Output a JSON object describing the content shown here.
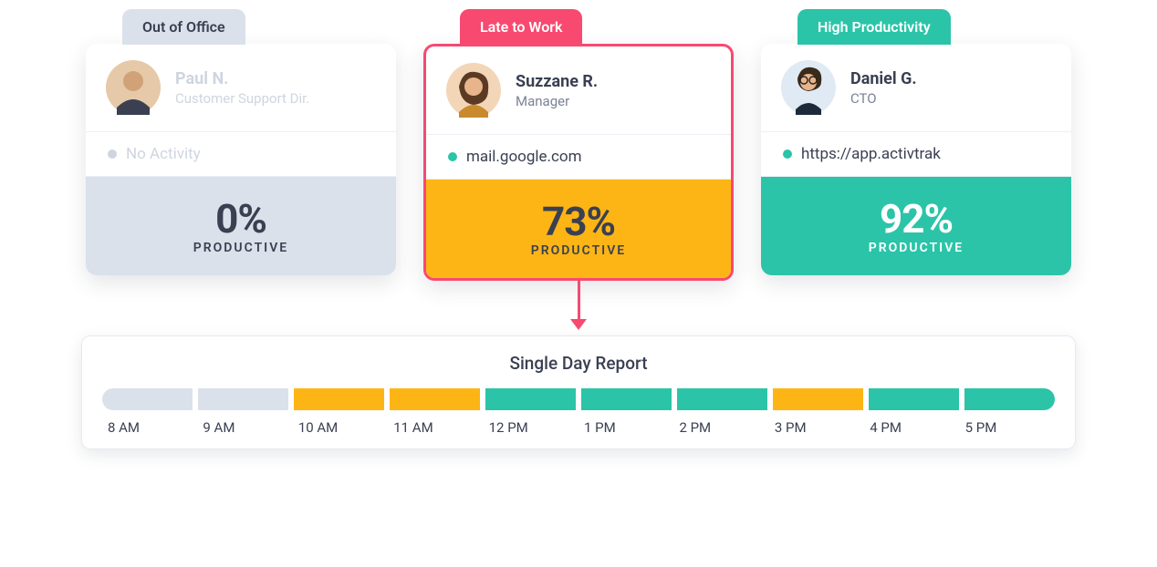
{
  "cards": [
    {
      "tab": "Out of Office",
      "tabStyle": "gray",
      "name": "Paul N.",
      "role": "Customer Support Dir.",
      "activity": "No Activity",
      "activityDot": "gray",
      "pct": "0%",
      "pctLabel": "PRODUCTIVE",
      "metricStyle": "gray",
      "faded": true,
      "highlighted": false
    },
    {
      "tab": "Late to Work",
      "tabStyle": "red",
      "name": "Suzzane R.",
      "role": "Manager",
      "activity": "mail.google.com",
      "activityDot": "teal",
      "pct": "73%",
      "pctLabel": "PRODUCTIVE",
      "metricStyle": "amber",
      "faded": false,
      "highlighted": true
    },
    {
      "tab": "High Productivity",
      "tabStyle": "teal",
      "name": "Daniel G.",
      "role": "CTO",
      "activity": "https://app.activtrak",
      "activityDot": "teal",
      "pct": "92%",
      "pctLabel": "PRODUCTIVE",
      "metricStyle": "teal",
      "faded": false,
      "highlighted": false
    }
  ],
  "report": {
    "title": "Single Day Report",
    "segments": [
      "gray",
      "gray",
      "amber",
      "amber",
      "teal",
      "teal",
      "teal",
      "amber",
      "teal",
      "teal"
    ],
    "times": [
      "8 AM",
      "9 AM",
      "10 AM",
      "11 AM",
      "12 PM",
      "1 PM",
      "2 PM",
      "3 PM",
      "4 PM",
      "5 PM"
    ]
  },
  "chart_data": {
    "type": "bar",
    "title": "Single Day Report",
    "categories": [
      "8 AM",
      "9 AM",
      "10 AM",
      "11 AM",
      "12 PM",
      "1 PM",
      "2 PM",
      "3 PM",
      "4 PM",
      "5 PM"
    ],
    "series": [
      {
        "name": "status",
        "values": [
          "no-activity",
          "no-activity",
          "unproductive",
          "unproductive",
          "productive",
          "productive",
          "productive",
          "unproductive",
          "productive",
          "productive"
        ]
      }
    ],
    "legend": {
      "no-activity": "#dbe1ea",
      "unproductive": "#fdb515",
      "productive": "#2bc4a8"
    }
  }
}
